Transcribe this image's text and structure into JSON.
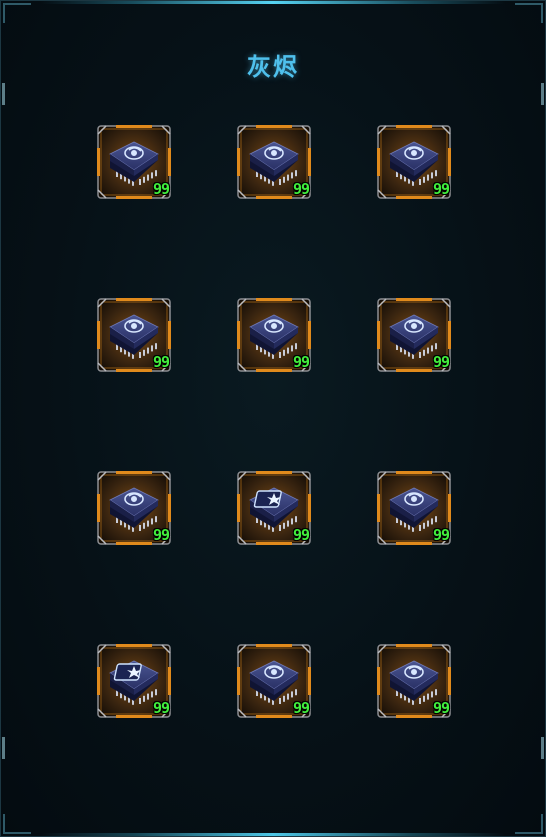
{
  "panel": {
    "title": "灰烬"
  },
  "items": [
    {
      "icon": "chip-swirl-icon",
      "count": "99"
    },
    {
      "icon": "chip-swirl-icon",
      "count": "99"
    },
    {
      "icon": "chip-swirl-icon",
      "count": "99"
    },
    {
      "icon": "chip-swirl-icon",
      "count": "99"
    },
    {
      "icon": "chip-swirl-icon",
      "count": "99"
    },
    {
      "icon": "chip-swirl-icon",
      "count": "99"
    },
    {
      "icon": "chip-swirl-icon",
      "count": "99"
    },
    {
      "icon": "chip-burst-icon",
      "count": "99"
    },
    {
      "icon": "chip-swirl-icon",
      "count": "99"
    },
    {
      "icon": "chip-burst-icon",
      "count": "99"
    },
    {
      "icon": "chip-swirl-icon",
      "count": "99"
    },
    {
      "icon": "chip-swirl-icon",
      "count": "99"
    }
  ],
  "colors": {
    "title": "#4fc0ec",
    "count": "#41ee3c",
    "slot_frame": "#e08a1c",
    "chip_body": "#2a3166",
    "chip_pins": "#c8ccd8"
  }
}
